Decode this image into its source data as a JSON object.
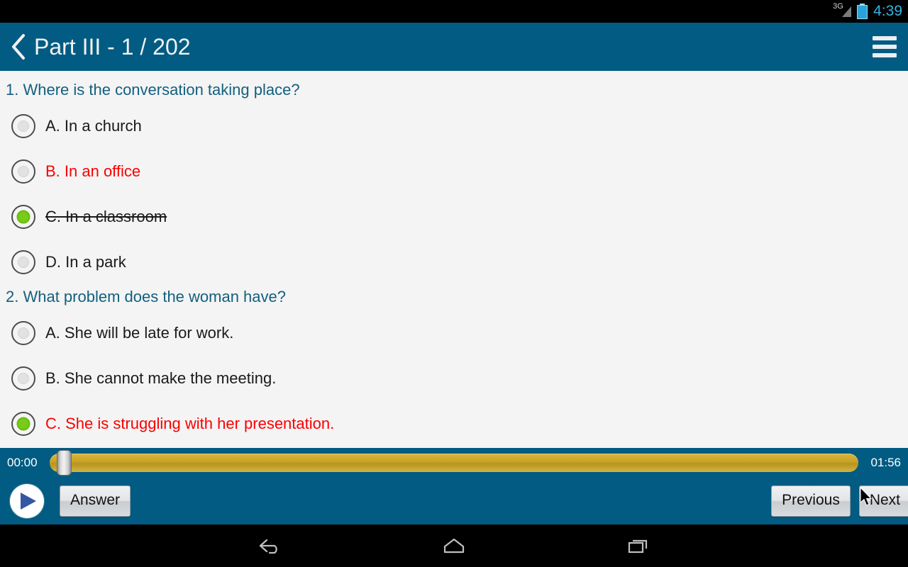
{
  "statusbar": {
    "network_label": "3G",
    "network_icon": "signal-bars-icon",
    "battery_icon": "battery-charging-icon",
    "time": "4:39",
    "time_color": "#33b5e5"
  },
  "appbar": {
    "back_icon": "chevron-left-icon",
    "title": "Part III  -  1 / 202",
    "menu_icon": "hamburger-menu-icon",
    "background_color": "#015b82"
  },
  "colors": {
    "accent": "#015b82",
    "question_text": "#13607f",
    "wrong_answer": "#fb0000",
    "selected_radio": "#76cc17",
    "content_background": "#f4f4f4",
    "seek_track": "#c9a327"
  },
  "questions": [
    {
      "number": "1.",
      "title": "1. Where is the conversation taking place?",
      "options": [
        {
          "label": "A. In a church",
          "selected": false,
          "red": false,
          "strike": false
        },
        {
          "label": "B. In an office",
          "selected": false,
          "red": true,
          "strike": false
        },
        {
          "label": "C. In a classroom",
          "selected": true,
          "red": false,
          "strike": true
        },
        {
          "label": "D. In a park",
          "selected": false,
          "red": false,
          "strike": false
        }
      ]
    },
    {
      "number": "2.",
      "title": "2. What problem does the woman have?",
      "options": [
        {
          "label": "A. She will be late for work.",
          "selected": false,
          "red": false,
          "strike": false
        },
        {
          "label": "B. She cannot make the meeting.",
          "selected": false,
          "red": false,
          "strike": false
        },
        {
          "label": "C. She is struggling with her presentation.",
          "selected": true,
          "red": true,
          "strike": false
        }
      ]
    }
  ],
  "player": {
    "current_time": "00:00",
    "total_time": "01:56",
    "progress_percent": 0,
    "play_icon": "play-triangle-icon",
    "answer_label": "Answer",
    "previous_label": "Previous",
    "next_label": "Next"
  },
  "navbar": {
    "back_icon": "android-back-icon",
    "home_icon": "android-home-icon",
    "recents_icon": "android-recents-icon"
  },
  "cursor": {
    "icon": "mouse-pointer-icon"
  }
}
